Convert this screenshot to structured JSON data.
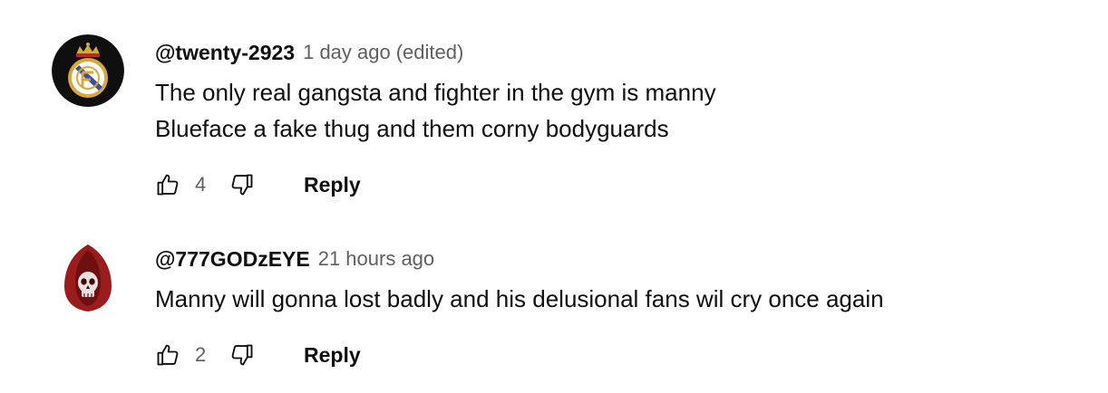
{
  "comments": [
    {
      "author": "@twenty-2923",
      "time": "1 day ago",
      "edited": "(edited)",
      "lines": [
        "The only real gangsta and fighter in the gym is manny",
        "Blueface a fake thug and them corny bodyguards"
      ],
      "likes": "4",
      "reply_label": "Reply",
      "avatar_icon": "crest-logo-icon"
    },
    {
      "author": "@777GODzEYE",
      "time": "21 hours ago",
      "lines": [
        "Manny will gonna lost badly and his delusional fans wil cry once again"
      ],
      "likes": "2",
      "reply_label": "Reply",
      "avatar_icon": "hooded-skull-icon"
    }
  ],
  "colors": {
    "text_primary": "#0f0f0f",
    "text_secondary": "#606060",
    "avatar1_bg": "#0f0f0f",
    "avatar1_gold": "#d7a93b",
    "avatar2_bg": "#ffffff",
    "avatar2_red": "#9b1c1c"
  }
}
